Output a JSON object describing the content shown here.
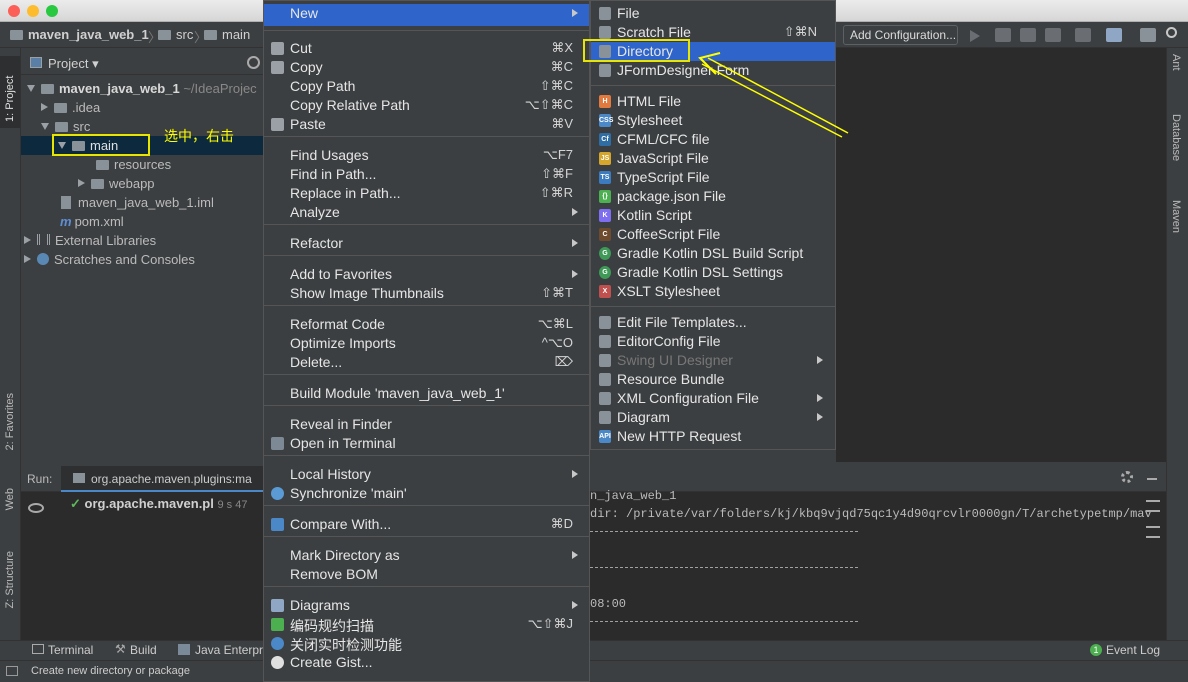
{
  "nav": {
    "crumbs": [
      "maven_java_web_1",
      "src",
      "main"
    ],
    "add_config": "Add Configuration..."
  },
  "left_tabs": {
    "project": "1: Project",
    "favorites": "2: Favorites",
    "web": "Web",
    "structure": "Z: Structure"
  },
  "right_tabs": {
    "ant": "Ant",
    "database": "Database",
    "maven": "Maven"
  },
  "project": {
    "header": "Project",
    "tree": [
      {
        "label": "maven_java_web_1",
        "extra": "~/IdeaProjec"
      },
      {
        "label": ".idea"
      },
      {
        "label": "src"
      },
      {
        "label": "main"
      },
      {
        "label": "resources"
      },
      {
        "label": "webapp"
      },
      {
        "label": "maven_java_web_1.iml"
      },
      {
        "label": "pom.xml"
      },
      {
        "label": "External Libraries"
      },
      {
        "label": "Scratches and Consoles"
      }
    ]
  },
  "annotation": {
    "text": "选中，右击",
    "color": "#ffff00"
  },
  "run": {
    "label": "Run:",
    "tab": "org.apache.maven.plugins:ma",
    "item": "org.apache.maven.pl",
    "time": "9 s 47",
    "console": [
      "n_java_web_1",
      "dir: /private/var/folders/kj/kbq9vjqd75qc1y4d90qrcvlr0000gn/T/archetypetmp/mav",
      "08:00"
    ]
  },
  "bottom_tabs": [
    "Terminal",
    "Build",
    "Java Enterpri"
  ],
  "event_log": "Event Log",
  "event_log_count": "1",
  "status": "Create new directory or package",
  "context_menu": {
    "items": [
      {
        "label": "New",
        "submenu": true,
        "highlight": true
      },
      {
        "label": "Cut",
        "shortcut": "⌘X",
        "icon": "cut"
      },
      {
        "label": "Copy",
        "shortcut": "⌘C",
        "icon": "copy"
      },
      {
        "label": "Copy Path",
        "shortcut": "⇧⌘C"
      },
      {
        "label": "Copy Relative Path",
        "shortcut": "⌥⇧⌘C"
      },
      {
        "label": "Paste",
        "shortcut": "⌘V",
        "icon": "paste"
      },
      {
        "label": "Find Usages",
        "shortcut": "⌥F7"
      },
      {
        "label": "Find in Path...",
        "shortcut": "⇧⌘F"
      },
      {
        "label": "Replace in Path...",
        "shortcut": "⇧⌘R"
      },
      {
        "label": "Analyze",
        "submenu": true
      },
      {
        "label": "Refactor",
        "submenu": true
      },
      {
        "label": "Add to Favorites",
        "submenu": true
      },
      {
        "label": "Show Image Thumbnails",
        "shortcut": "⇧⌘T"
      },
      {
        "label": "Reformat Code",
        "shortcut": "⌥⌘L"
      },
      {
        "label": "Optimize Imports",
        "shortcut": "^⌥O"
      },
      {
        "label": "Delete...",
        "shortcut": "⌦"
      },
      {
        "label": "Build Module 'maven_java_web_1'"
      },
      {
        "label": "Reveal in Finder"
      },
      {
        "label": "Open in Terminal",
        "icon": "terminal"
      },
      {
        "label": "Local History",
        "submenu": true
      },
      {
        "label": "Synchronize 'main'",
        "icon": "sync"
      },
      {
        "label": "Compare With...",
        "shortcut": "⌘D",
        "icon": "compare"
      },
      {
        "label": "Mark Directory as",
        "submenu": true
      },
      {
        "label": "Remove BOM"
      },
      {
        "label": "Diagrams",
        "submenu": true,
        "icon": "diagram"
      },
      {
        "label": "编码规约扫描",
        "shortcut": "⌥⇧⌘J",
        "icon": "scan"
      },
      {
        "label": "关闭实时检测功能",
        "icon": "stop"
      },
      {
        "label": "Create Gist...",
        "icon": "github"
      }
    ]
  },
  "new_submenu": {
    "items": [
      {
        "label": "File"
      },
      {
        "label": "Scratch File",
        "shortcut": "⇧⌘N"
      },
      {
        "label": "Directory",
        "highlight": true
      },
      {
        "label": "JFormDesigner Form"
      },
      {
        "label": "HTML File",
        "tag": "H"
      },
      {
        "label": "Stylesheet",
        "tag": "CSS"
      },
      {
        "label": "CFML/CFC file",
        "tag": "Cf"
      },
      {
        "label": "JavaScript File",
        "tag": "JS"
      },
      {
        "label": "TypeScript File",
        "tag": "TS"
      },
      {
        "label": "package.json File",
        "tag": "{}"
      },
      {
        "label": "Kotlin Script",
        "tag": "K"
      },
      {
        "label": "CoffeeScript File",
        "tag": "C"
      },
      {
        "label": "Gradle Kotlin DSL Build Script",
        "tag": "G"
      },
      {
        "label": "Gradle Kotlin DSL Settings",
        "tag": "G"
      },
      {
        "label": "XSLT Stylesheet",
        "tag": "X"
      },
      {
        "label": "Edit File Templates..."
      },
      {
        "label": "EditorConfig File"
      },
      {
        "label": "Swing UI Designer",
        "submenu": true,
        "disabled": true
      },
      {
        "label": "Resource Bundle"
      },
      {
        "label": "XML Configuration File",
        "submenu": true
      },
      {
        "label": "Diagram",
        "submenu": true
      },
      {
        "label": "New HTTP Request",
        "tag": "API"
      }
    ]
  }
}
